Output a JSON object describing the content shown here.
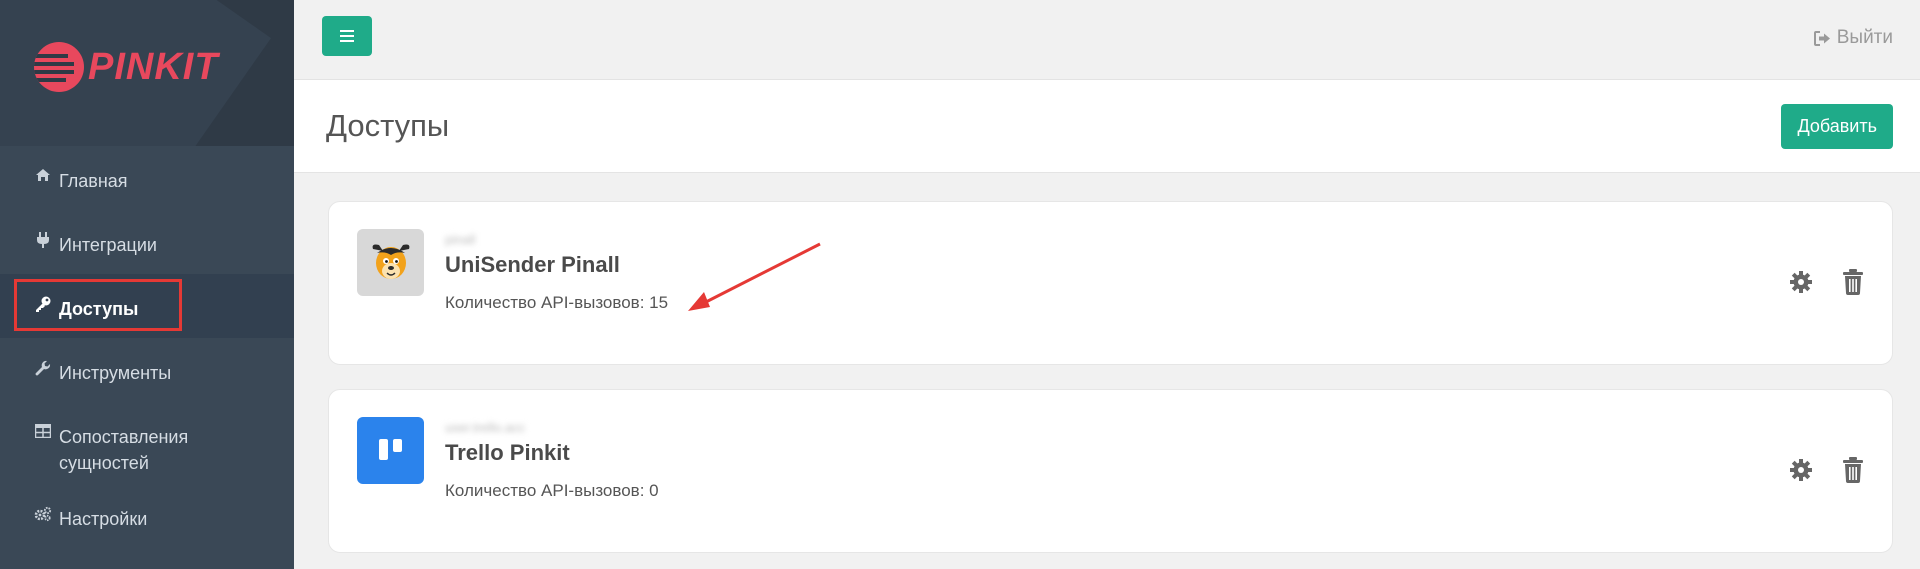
{
  "brand": {
    "logo_text": "PINKIT",
    "accent": "#e8485d"
  },
  "sidebar": {
    "items": [
      {
        "label": "Главная",
        "icon": "home-icon"
      },
      {
        "label": "Интеграции",
        "icon": "plug-icon"
      },
      {
        "label": "Доступы",
        "icon": "key-icon",
        "active": true
      },
      {
        "label": "Инструменты",
        "icon": "wrench-icon"
      },
      {
        "label": "Сопоставления сущностей",
        "icon": "table-icon"
      },
      {
        "label": "Настройки",
        "icon": "cogs-icon"
      }
    ]
  },
  "topbar": {
    "logout_label": "Выйти"
  },
  "page": {
    "title": "Доступы",
    "add_label": "Добавить"
  },
  "accesses": [
    {
      "name": "UniSender Pinall",
      "sub": "pinall",
      "count_text": "Количество API-вызовов: 15",
      "icon": "unisender-logo"
    },
    {
      "name": "Trello Pinkit",
      "sub": "user.trello.acc",
      "count_text": "Количество API-вызовов: 0",
      "icon": "trello-logo"
    }
  ],
  "colors": {
    "primary": "#1fab89",
    "sidebar": "#3a4856",
    "annotation": "#e53935"
  }
}
